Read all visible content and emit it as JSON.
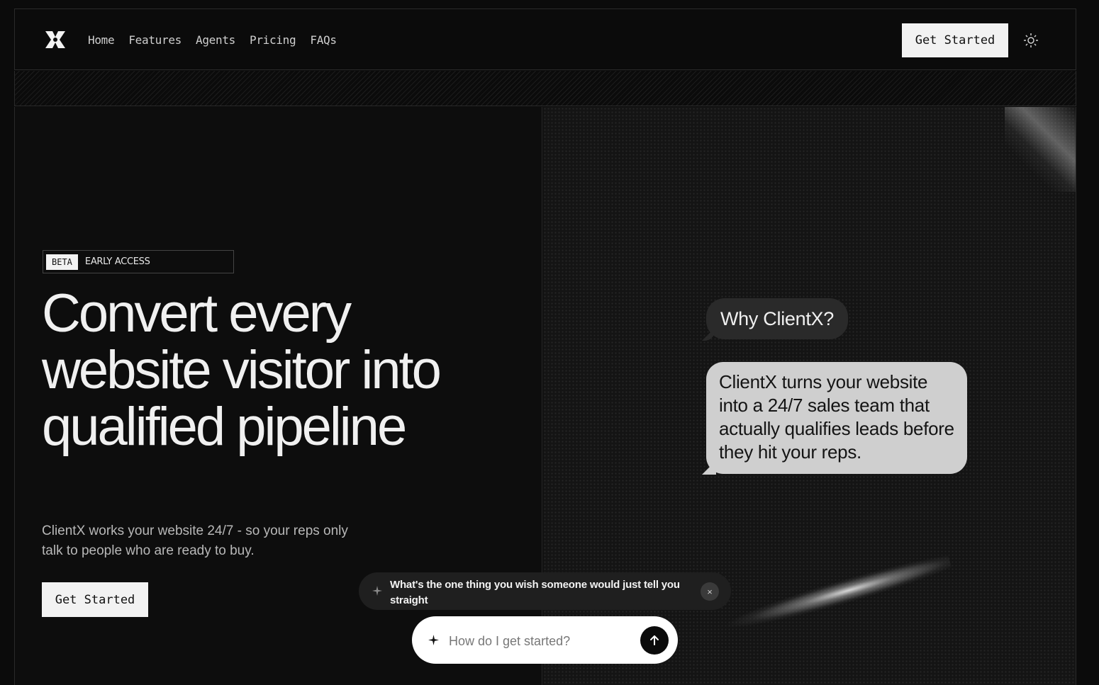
{
  "header": {
    "logo_icon": "x-logo-icon",
    "nav": [
      {
        "label": "Home"
      },
      {
        "label": "Features"
      },
      {
        "label": "Agents"
      },
      {
        "label": "Pricing"
      },
      {
        "label": "FAQs"
      }
    ],
    "cta_label": "Get Started",
    "theme_icon": "sun-icon"
  },
  "hero": {
    "badge_tag": "BETA",
    "badge_text": "EARLY ACCESS",
    "headline_lines": [
      "Convert every",
      "website visitor into",
      "qualified pipeline"
    ],
    "subtitle": "ClientX works your website 24/7 - so your reps only talk to people who are ready to buy.",
    "cta_label": "Get Started"
  },
  "chat_demo": {
    "question": "Why ClientX?",
    "answer": "ClientX turns your website into a 24/7 sales team that actually qualifies leads before they hit your reps."
  },
  "widget": {
    "suggestion": "What's the one thing you wish someone would just tell you straight",
    "close_label": "×",
    "input_placeholder": "How do I get started?"
  },
  "colors": {
    "background": "#0b0b0b",
    "accent": "#f2f2f2",
    "bubble_answer": "#cfcfcf",
    "bubble_question": "#2a2a2a"
  }
}
